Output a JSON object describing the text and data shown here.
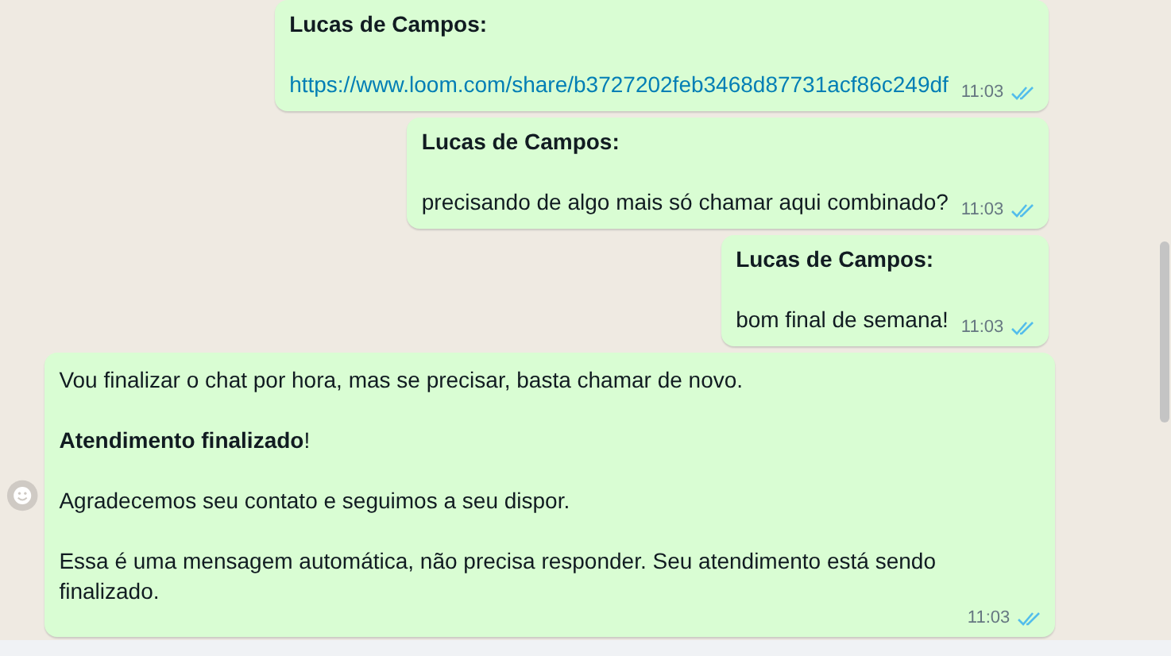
{
  "messages": [
    {
      "kind": "outgoing",
      "paragraphs": [
        {
          "kind": "sender",
          "text": "Lucas de Campos:"
        },
        {
          "kind": "link",
          "text": "https://www.loom.com/share/b3727202feb3468d87731acf86c249df"
        }
      ],
      "time": "11:03",
      "read": true
    },
    {
      "kind": "outgoing",
      "paragraphs": [
        {
          "kind": "sender",
          "text": "Lucas de Campos:"
        },
        {
          "kind": "text",
          "text": "precisando de algo mais só chamar aqui combinado?"
        }
      ],
      "time": "11:03",
      "read": true
    },
    {
      "kind": "outgoing",
      "paragraphs": [
        {
          "kind": "sender",
          "text": "Lucas de Campos:"
        },
        {
          "kind": "text",
          "text": "bom final de semana!"
        }
      ],
      "time": "11:03",
      "read": true
    },
    {
      "kind": "full",
      "paragraphs": [
        {
          "kind": "text",
          "text": "Vou finalizar o chat por hora, mas se precisar, basta chamar de novo."
        },
        {
          "kind": "text",
          "text": "**Atendimento finalizado**!"
        },
        {
          "kind": "text",
          "text": "Agradecemos seu contato e seguimos a seu dispor."
        },
        {
          "kind": "text",
          "text": "Essa é uma mensagem automática, não precisa responder. Seu atendimento está sendo finalizado."
        }
      ],
      "time": "11:03",
      "read": true
    }
  ]
}
